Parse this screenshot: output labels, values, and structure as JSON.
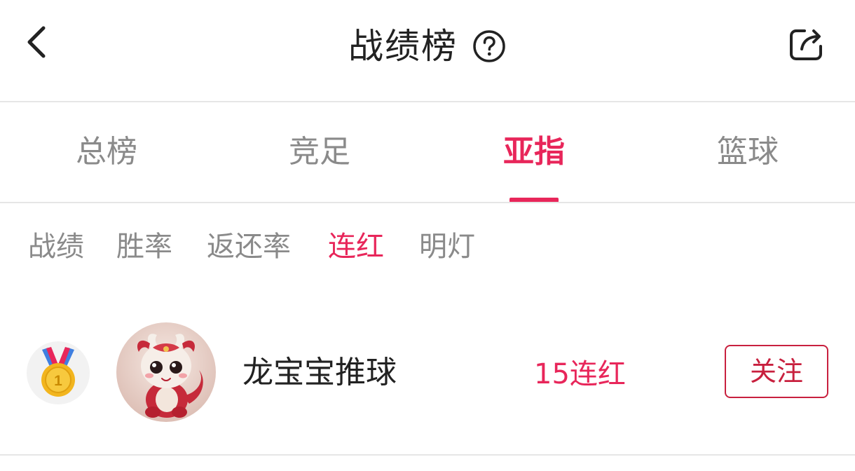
{
  "header": {
    "title": "战绩榜",
    "back_icon": "chevron-left-icon",
    "help_icon": "question-circle-icon",
    "share_icon": "share-icon"
  },
  "tabs": [
    {
      "label": "总榜",
      "active": false
    },
    {
      "label": "竞足",
      "active": false
    },
    {
      "label": "亚指",
      "active": true
    },
    {
      "label": "篮球",
      "active": false
    }
  ],
  "subtabs": [
    {
      "label": "战绩",
      "active": false
    },
    {
      "label": "胜率",
      "active": false
    },
    {
      "label": "返还率",
      "active": false
    },
    {
      "label": "连红",
      "active": true
    },
    {
      "label": "明灯",
      "active": false
    }
  ],
  "ranking": [
    {
      "rank": "1",
      "rank_icon": "gold-medal-icon",
      "avatar": "dragon-avatar",
      "name": "龙宝宝推球",
      "streak": "15连红",
      "follow_label": "关注"
    }
  ],
  "colors": {
    "accent": "#e8265a",
    "follow_border": "#c8203e",
    "inactive_text": "#8a8a8a",
    "primary_text": "#222222",
    "divider": "#e6e6e6"
  }
}
